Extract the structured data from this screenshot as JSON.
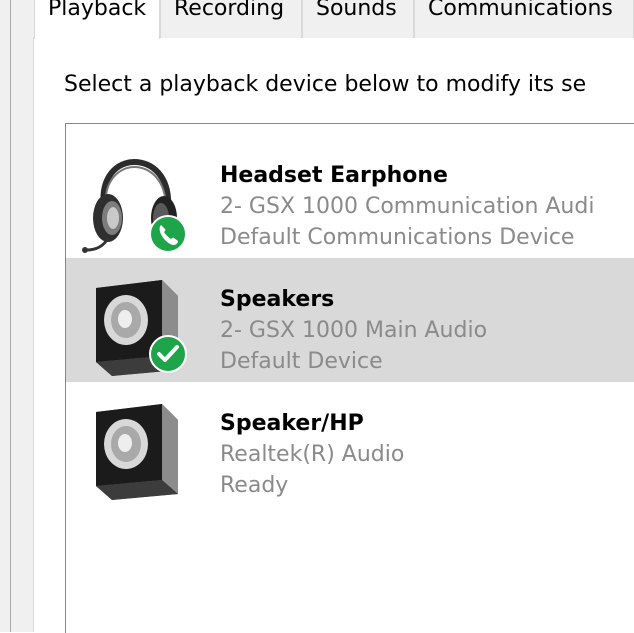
{
  "tabs": [
    {
      "label": "Playback",
      "active": true
    },
    {
      "label": "Recording",
      "active": false
    },
    {
      "label": "Sounds",
      "active": false
    },
    {
      "label": "Communications",
      "active": false
    }
  ],
  "instruction": "Select a playback device below to modify its se",
  "devices": [
    {
      "name": "Headset Earphone",
      "description": "2- GSX 1000 Communication Audi",
      "status": "Default Communications Device",
      "icon": "headset-icon",
      "badge": "phone-badge-icon",
      "selected": false
    },
    {
      "name": "Speakers",
      "description": "2- GSX 1000 Main Audio",
      "status": "Default Device",
      "icon": "speaker-icon",
      "badge": "green-check-badge-icon",
      "selected": true
    },
    {
      "name": "Speaker/HP",
      "description": "Realtek(R) Audio",
      "status": "Ready",
      "icon": "speaker-icon",
      "badge": "",
      "selected": false
    }
  ],
  "colors": {
    "badge_green": "#1ea54a",
    "selected_row": "#d9d9d9",
    "secondary_text": "#8a8a8a",
    "dialog_background": "#f0f0f0"
  }
}
